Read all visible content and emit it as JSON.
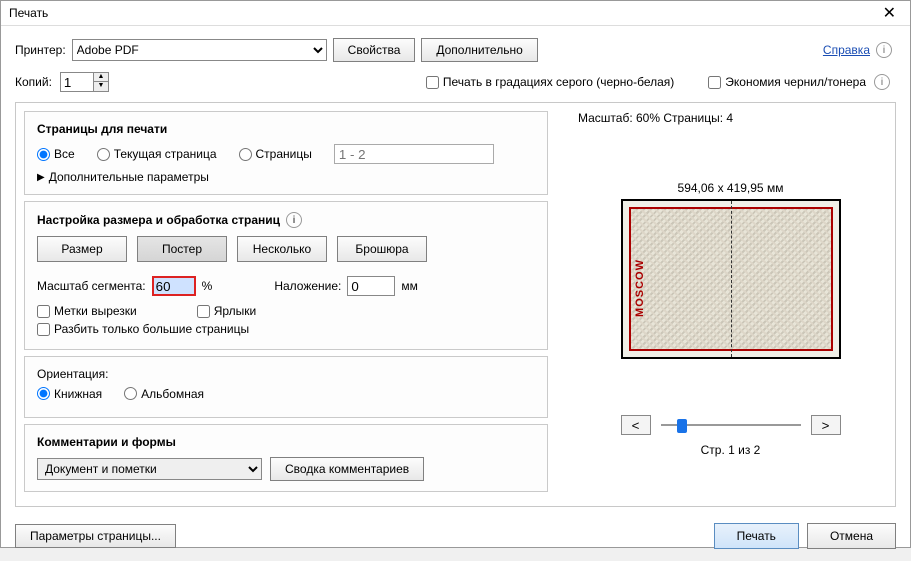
{
  "title": "Печать",
  "printer_label": "Принтер:",
  "printer_value": "Adobe PDF",
  "props_btn": "Свойства",
  "advanced_btn": "Дополнительно",
  "help_link": "Справка",
  "copies_label": "Копий:",
  "copies_value": "1",
  "grayscale_label": "Печать в градациях серого (черно-белая)",
  "ink_label": "Экономия чернил/тонера",
  "pages_section_title": "Страницы для печати",
  "radio_all": "Все",
  "radio_current": "Текущая страница",
  "radio_pages": "Страницы",
  "pages_placeholder": "1 - 2",
  "more_params": "Дополнительные параметры",
  "size_section_title": "Настройка размера и обработка страниц",
  "tab_size": "Размер",
  "tab_poster": "Постер",
  "tab_multi": "Несколько",
  "tab_brochure": "Брошюра",
  "scale_label": "Масштаб сегмента:",
  "scale_value": "60",
  "scale_pct": "%",
  "overlap_label": "Наложение:",
  "overlap_value": "0",
  "overlap_unit": "мм",
  "cutmarks_label": "Метки вырезки",
  "labels_label": "Ярлыки",
  "bigpages_label": "Разбить только большие страницы",
  "orient_title": "Ориентация:",
  "orient_portrait": "Книжная",
  "orient_landscape": "Альбомная",
  "comments_title": "Комментарии и формы",
  "comments_value": "Документ и пометки",
  "comments_summary_btn": "Сводка комментариев",
  "preview_scale": "Масштаб:  60% Страницы: 4",
  "preview_dims": "594,06 x 419,95 мм",
  "map_label": "MOSCOW",
  "nav_prev": "<",
  "nav_next": ">",
  "page_indicator": "Стр. 1 из 2",
  "page_setup_btn": "Параметры страницы...",
  "print_btn": "Печать",
  "cancel_btn": "Отмена"
}
